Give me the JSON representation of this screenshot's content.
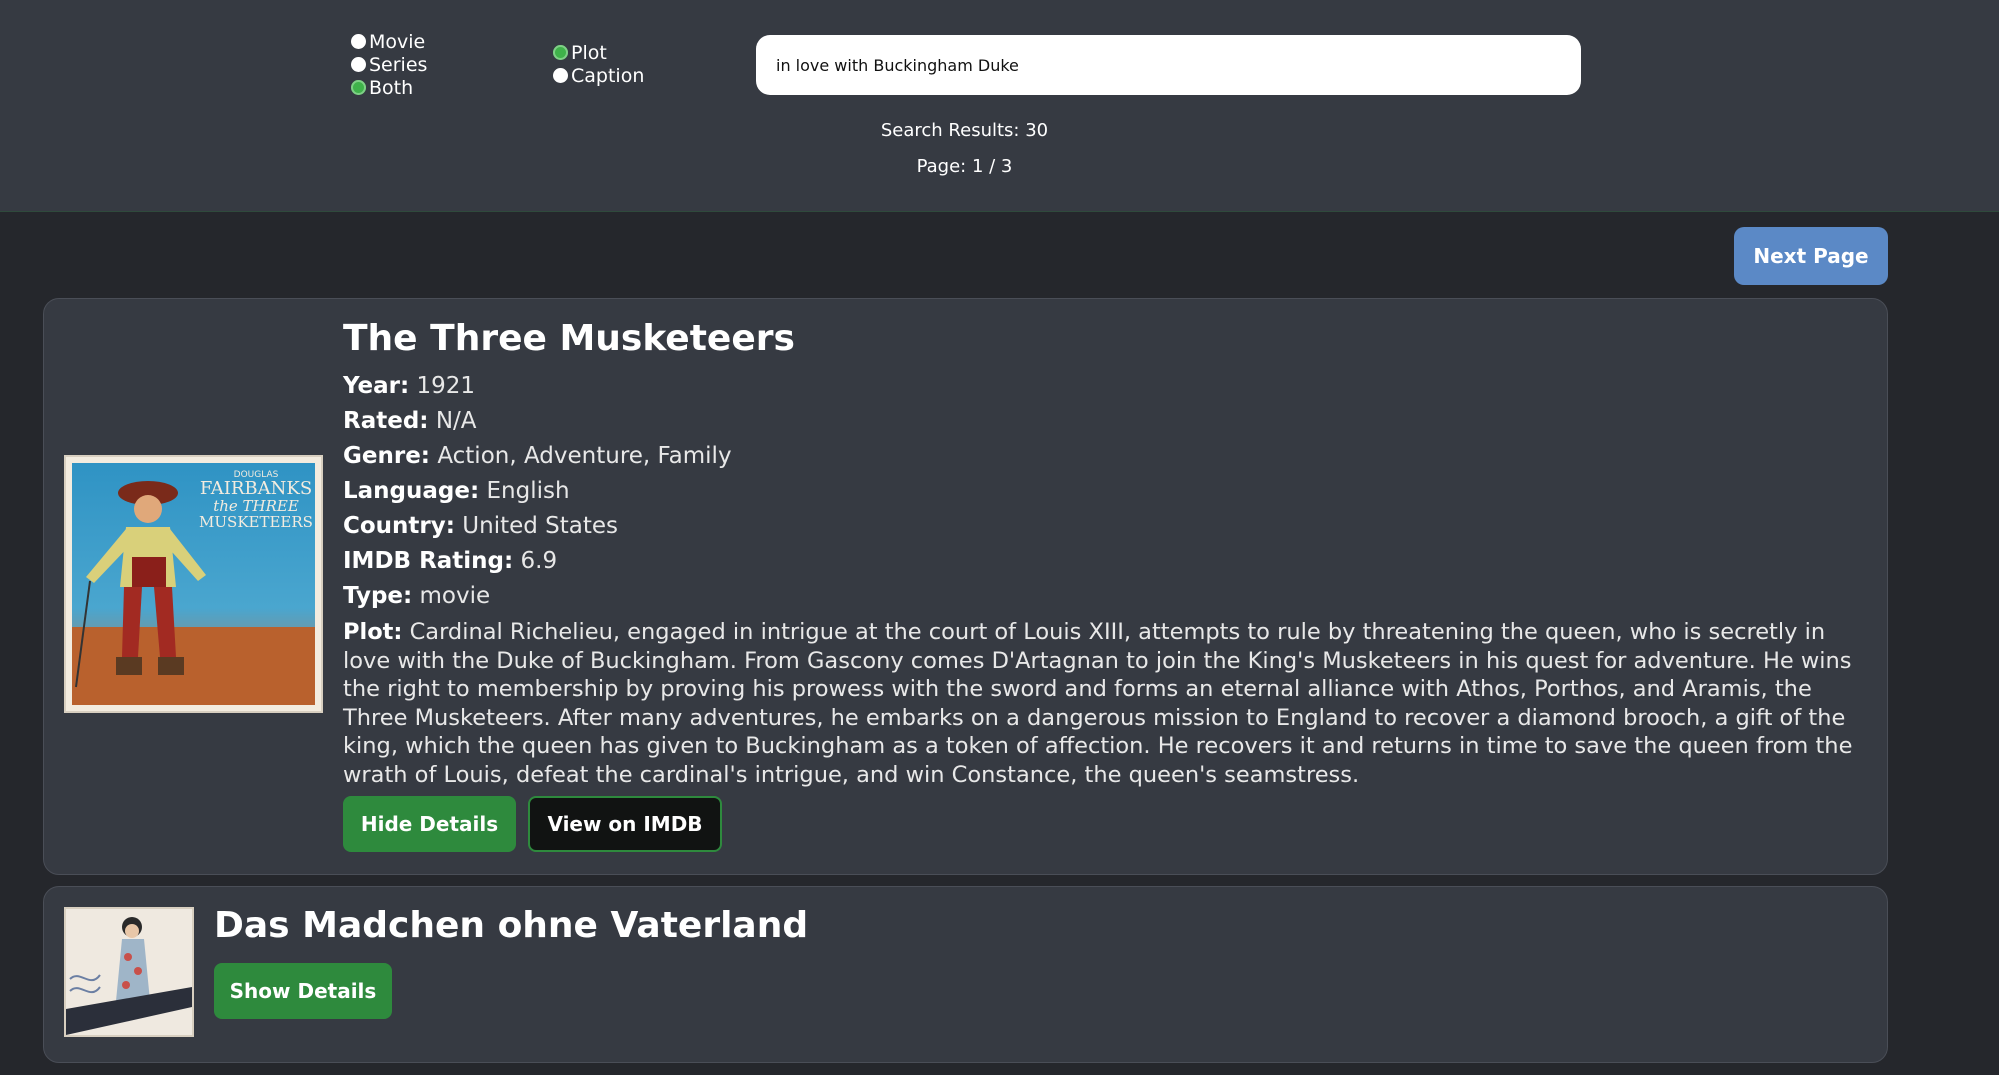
{
  "filters": {
    "type": [
      {
        "label": "Movie",
        "checked": false
      },
      {
        "label": "Series",
        "checked": false
      },
      {
        "label": "Both",
        "checked": true
      }
    ],
    "field": [
      {
        "label": "Plot",
        "checked": true
      },
      {
        "label": "Caption",
        "checked": false
      }
    ]
  },
  "search": {
    "value": "in love with Buckingham Duke"
  },
  "results": {
    "count_text": "Search Results: 30",
    "page_text": "Page: 1 / 3"
  },
  "pagination": {
    "next_label": "Next Page"
  },
  "movies": [
    {
      "title": "The Three Musketeers",
      "poster": {
        "top_small": "DOUGLAS",
        "name": "FAIRBANKS",
        "line1": "the THREE",
        "line2": "MUSKETEERS"
      },
      "fields": [
        {
          "label": "Year:",
          "value": "1921"
        },
        {
          "label": "Rated:",
          "value": "N/A"
        },
        {
          "label": "Genre:",
          "value": "Action, Adventure, Family"
        },
        {
          "label": "Language:",
          "value": "English"
        },
        {
          "label": "Country:",
          "value": "United States"
        },
        {
          "label": "IMDB Rating:",
          "value": "6.9"
        },
        {
          "label": "Type:",
          "value": "movie"
        }
      ],
      "plot_label": "Plot:",
      "plot": "Cardinal Richelieu, engaged in intrigue at the court of Louis XIII, attempts to rule by threatening the queen, who is secretly in love with the Duke of Buckingham. From Gascony comes D'Artagnan to join the King's Musketeers in his quest for adventure. He wins the right to membership by proving his prowess with the sword and forms an eternal alliance with Athos, Porthos, and Aramis, the Three Musketeers. After many adventures, he embarks on a dangerous mission to England to recover a diamond brooch, a gift of the king, which the queen has given to Buckingham as a token of affection. He recovers it and returns in time to save the queen from the wrath of Louis, defeat the cardinal's intrigue, and win Constance, the queen's seamstress.",
      "hide_label": "Hide Details",
      "imdb_label": "View on IMDB"
    },
    {
      "title": "Das Madchen ohne Vaterland",
      "show_label": "Show Details"
    }
  ]
}
